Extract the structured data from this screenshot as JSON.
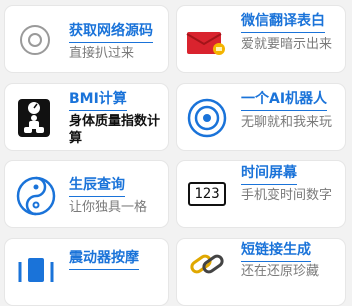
{
  "cards": [
    {
      "title": "获取网络源码",
      "subtitle": "直接扒过来",
      "icon": "target-circle-icon"
    },
    {
      "title": "微信翻译表白",
      "subtitle": "爱就要暗示出来",
      "icon": "red-envelope-icon"
    },
    {
      "title": "BMI计算",
      "subtitle": "身体质量指数计算",
      "icon": "scale-person-icon"
    },
    {
      "title": "一个AI机器人",
      "subtitle": "无聊就和我来玩",
      "icon": "ai-ring-icon"
    },
    {
      "title": "生辰查询",
      "subtitle": "让你独具一格",
      "icon": "yin-yang-icon"
    },
    {
      "title": "时间屏幕",
      "subtitle": "手机变时间数字",
      "icon": "digital-clock-icon",
      "icon_text": "123"
    },
    {
      "title": "震动器按摩",
      "subtitle": "",
      "icon": "vibration-icon"
    },
    {
      "title": "短链接生成",
      "subtitle": "还在还原珍藏",
      "icon": "link-icon"
    }
  ],
  "colors": {
    "accent": "#1a73d9",
    "background": "#f2f2f2"
  }
}
